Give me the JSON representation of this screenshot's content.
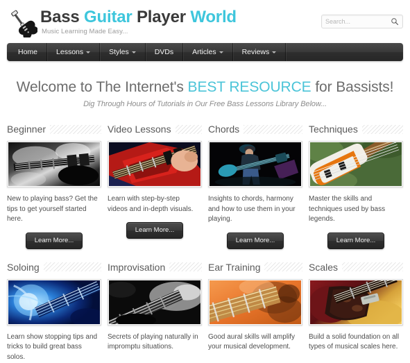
{
  "header": {
    "logo_icon": "bass-guitar-icon",
    "brand_part1": "Bass ",
    "brand_part2": "Guitar",
    "brand_part3": " Player ",
    "brand_part4": "World",
    "tagline": "Music Learning Made Easy...",
    "accent_color": "#3ec6dc"
  },
  "search": {
    "placeholder": "Search...",
    "value": "",
    "icon": "search-icon"
  },
  "nav": {
    "items": [
      {
        "label": "Home",
        "has_dropdown": false
      },
      {
        "label": "Lessons",
        "has_dropdown": true
      },
      {
        "label": "Styles",
        "has_dropdown": true
      },
      {
        "label": "DVDs",
        "has_dropdown": false
      },
      {
        "label": "Articles",
        "has_dropdown": true
      },
      {
        "label": "Reviews",
        "has_dropdown": true
      }
    ]
  },
  "hero": {
    "title_part1": "Welcome to The Internet's ",
    "title_accent": "BEST RESOURCE",
    "title_part2": " for Bassists!",
    "subtitle": "Dig Through Hours of Tutorials in Our Free Bass Lessons Library Below...",
    "accent_color": "#4bc4d8"
  },
  "cards": {
    "button_label": "Learn More...",
    "row1": [
      {
        "title": "Beginner",
        "description": "New to playing bass? Get the tips to get yourself started here.",
        "image_alt": "black-and-white-bass-guitar-body-photo",
        "image_colors": [
          "#0a0a0a",
          "#cfcfcf",
          "#5a5a5a",
          "#1a1a1a"
        ]
      },
      {
        "title": "Video Lessons",
        "description": "Learn with step-by-step videos and in-depth visuals.",
        "image_alt": "red-bass-guitar-being-played-photo",
        "image_colors": [
          "#0b0d1e",
          "#c01a18",
          "#e8b79a",
          "#1a1a2e"
        ]
      },
      {
        "title": "Chords",
        "description": "Insights to chords, harmony and how to use them in your playing.",
        "image_alt": "bassist-on-stage-with-teal-bass-photo",
        "image_colors": [
          "#050505",
          "#2a8fa8",
          "#3f5f8a",
          "#6a2a7a"
        ]
      },
      {
        "title": "Techniques",
        "description": "Master the skills and techniques used by bass legends.",
        "image_alt": "sunburst-bass-guitar-outdoors-photo",
        "image_colors": [
          "#3d5a2a",
          "#f3f1ec",
          "#c8761e",
          "#8a5a2a"
        ]
      }
    ],
    "row2": [
      {
        "title": "Soloing",
        "description": "Learn show stopping tips and tricks to build great bass solos.",
        "image_alt": "blue-lit-bass-guitar-closeup-photo",
        "image_colors": [
          "#03103f",
          "#1f6fd0",
          "#9fd6ff",
          "#061a4a"
        ]
      },
      {
        "title": "Improvisation",
        "description": "Secrets of playing naturally in impromptu situations.",
        "image_alt": "grayscale-fretboard-and-hand-photo",
        "image_colors": [
          "#0c0c0c",
          "#9c9c9c",
          "#e0e0e0",
          "#2c2c2c"
        ]
      },
      {
        "title": "Ear Training",
        "description": "Good aural skills will amplify your musical development.",
        "image_alt": "orange-toned-bass-neck-photo",
        "image_colors": [
          "#e8742a",
          "#f0a86a",
          "#7a3a12",
          "#c9601d"
        ]
      },
      {
        "title": "Scales",
        "description": "Build a solid foundation on all types of musical scales here.",
        "image_alt": "jazz-bass-with-tortoiseshell-pickguard-photo",
        "image_colors": [
          "#6b1418",
          "#1a0e0c",
          "#d6a23a",
          "#3a2218"
        ]
      }
    ]
  }
}
